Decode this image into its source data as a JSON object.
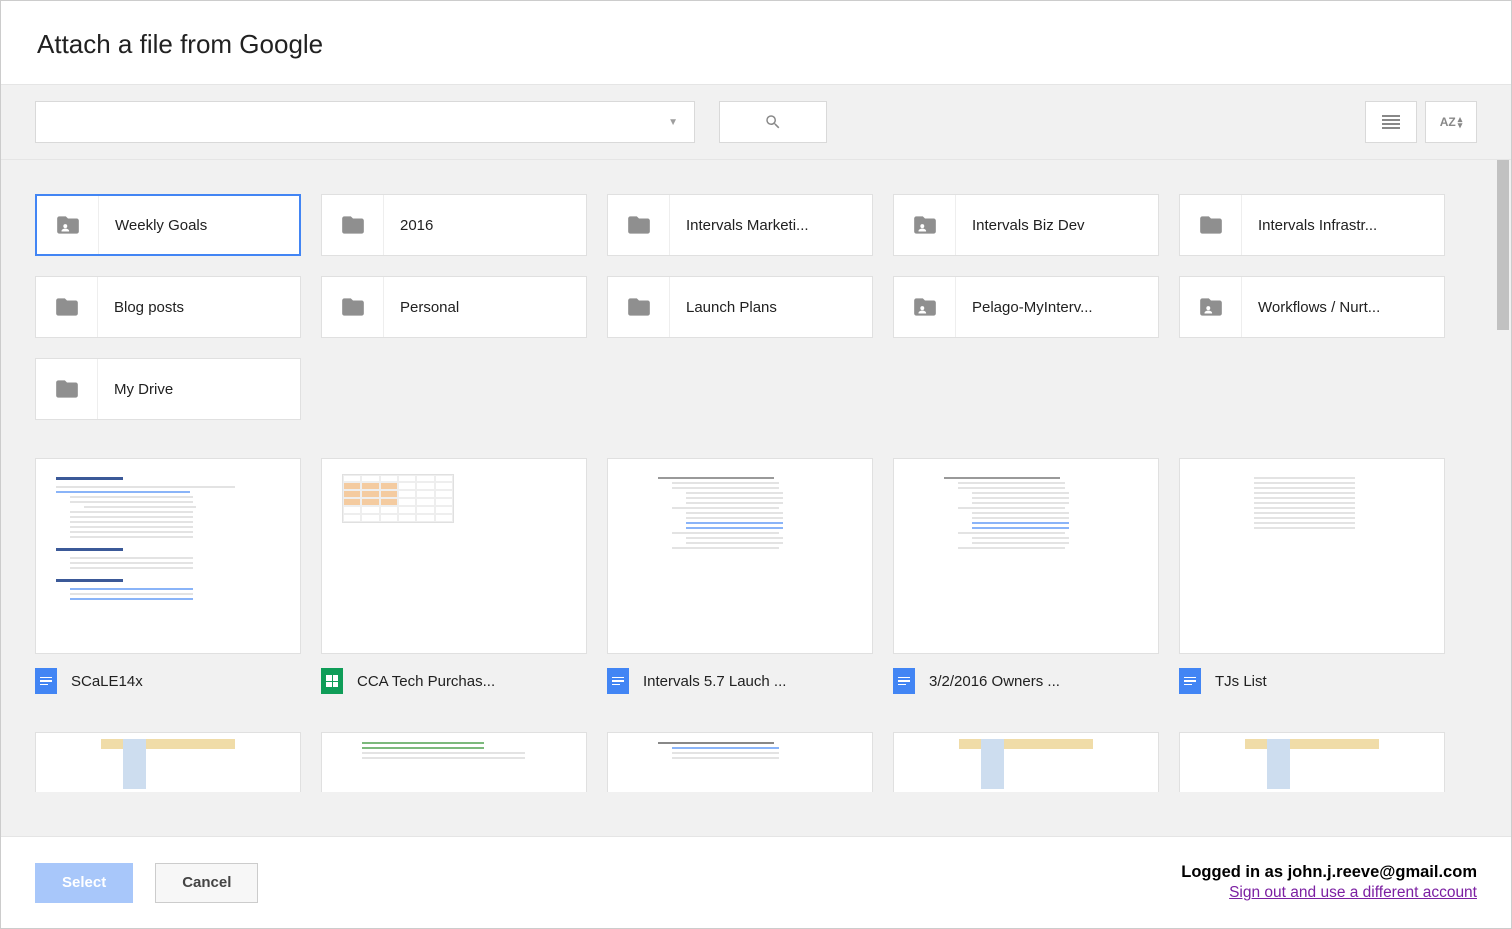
{
  "header": {
    "title": "Attach a file from Google"
  },
  "toolbar": {
    "search_value": "",
    "search_placeholder": ""
  },
  "folders": [
    {
      "label": "Weekly Goals",
      "shared": true,
      "selected": true
    },
    {
      "label": "2016",
      "shared": false,
      "selected": false
    },
    {
      "label": "Intervals Marketi...",
      "shared": false,
      "selected": false
    },
    {
      "label": "Intervals Biz Dev",
      "shared": true,
      "selected": false
    },
    {
      "label": "Intervals Infrastr...",
      "shared": false,
      "selected": false
    },
    {
      "label": "Blog posts",
      "shared": false,
      "selected": false
    },
    {
      "label": "Personal",
      "shared": false,
      "selected": false
    },
    {
      "label": "Launch Plans",
      "shared": false,
      "selected": false
    },
    {
      "label": "Pelago-MyInterv...",
      "shared": true,
      "selected": false
    },
    {
      "label": "Workflows / Nurt...",
      "shared": true,
      "selected": false
    },
    {
      "label": "My Drive",
      "shared": false,
      "selected": false
    }
  ],
  "files": [
    {
      "name": "SCaLE14x",
      "type": "doc",
      "thumb": "outline-long"
    },
    {
      "name": "CCA Tech Purchas...",
      "type": "sheet",
      "thumb": "sheet"
    },
    {
      "name": "Intervals 5.7 Lauch ...",
      "type": "doc",
      "thumb": "outline-med"
    },
    {
      "name": "3/2/2016 Owners ...",
      "type": "doc",
      "thumb": "outline-med"
    },
    {
      "name": "TJs List",
      "type": "doc",
      "thumb": "outline-short"
    }
  ],
  "partial_thumbs": [
    {
      "thumb": "table-partial"
    },
    {
      "thumb": "text-partial"
    },
    {
      "thumb": "outline-partial"
    },
    {
      "thumb": "table-partial"
    },
    {
      "thumb": "table-partial"
    }
  ],
  "footer": {
    "select_label": "Select",
    "cancel_label": "Cancel",
    "logged_in_text": "Logged in as john.j.reeve@gmail.com",
    "signout_text": "Sign out and use a different account"
  }
}
